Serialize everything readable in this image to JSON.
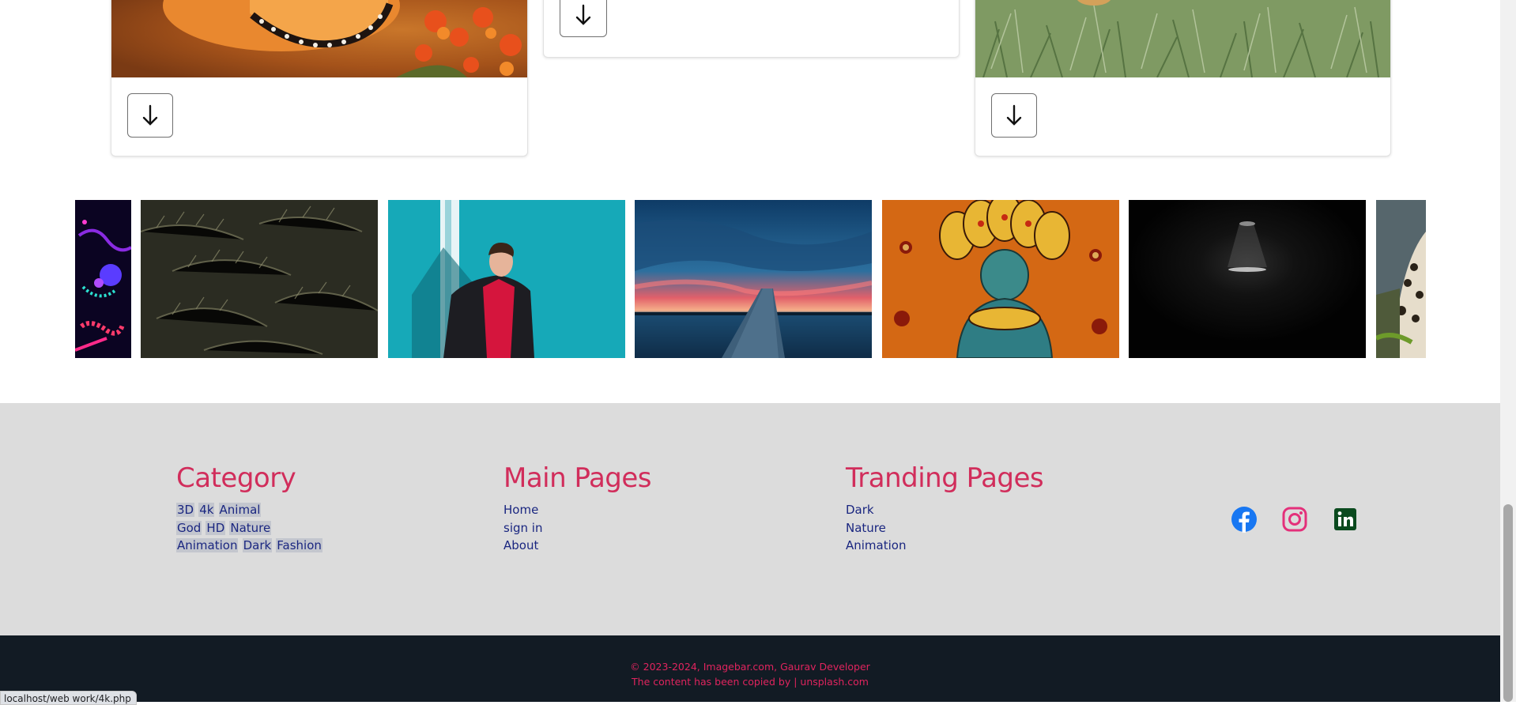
{
  "cards": {
    "download_icon": "arrow-down-icon",
    "download_glyph": "↓"
  },
  "strip": {
    "images": [
      "abstract-neon",
      "pine-branches",
      "man-teal-wall",
      "lake-pier-sunset",
      "naga-deity-painting",
      "dark-tunnel-light",
      "leopard"
    ]
  },
  "footer": {
    "category": {
      "title": "Category",
      "rows": [
        [
          "3D",
          "4k",
          "Animal"
        ],
        [
          "God",
          "HD",
          "Nature"
        ],
        [
          "Animation",
          "Dark",
          "Fashion"
        ]
      ]
    },
    "main_pages": {
      "title": "Main Pages",
      "links": [
        "Home",
        "sign in",
        "About"
      ]
    },
    "trending_pages": {
      "title": "Tranding Pages",
      "links": [
        "Dark",
        "Nature",
        "Animation"
      ]
    },
    "social": [
      "facebook-icon",
      "instagram-icon",
      "linkedin-icon"
    ]
  },
  "bottom": {
    "copyright": "© 2023-2024, Imagebar.com, Gaurav Developer",
    "credit": "The content has been copied by | unsplash.com"
  },
  "status_url": "localhost/web work/4k.php",
  "colors": {
    "accent": "#d12d5b",
    "link": "#1a2680",
    "footer_bg": "#dcdcdc",
    "bottom_bg": "#121b24",
    "facebook": "#1877f2",
    "instagram": "#e4307a",
    "linkedin": "#0a4a1e"
  }
}
